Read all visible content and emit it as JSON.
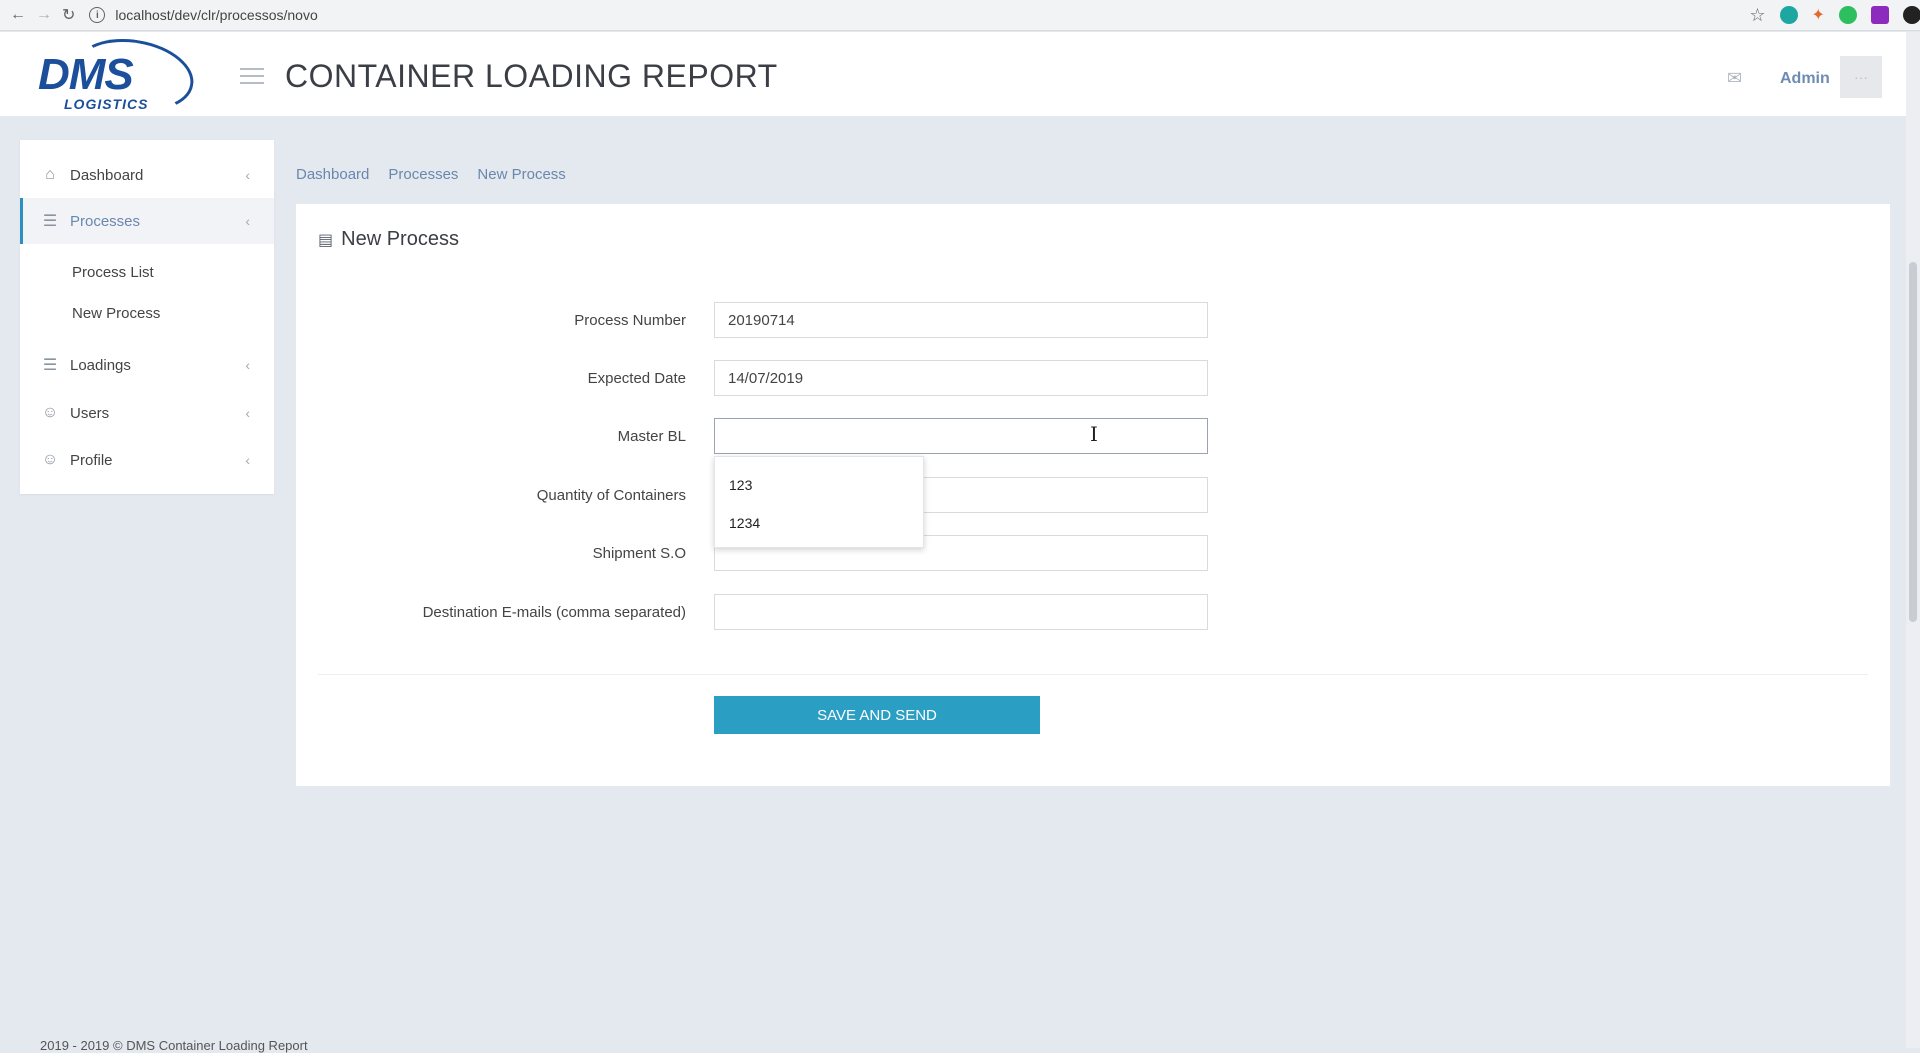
{
  "browser": {
    "url": "localhost/dev/clr/processos/novo"
  },
  "header": {
    "logo_text": "DMS",
    "logo_sub": "LOGISTICS",
    "title": "CONTAINER LOADING REPORT",
    "user": "Admin"
  },
  "sidebar": {
    "items": [
      {
        "label": "Dashboard",
        "icon": "home-icon"
      },
      {
        "label": "Processes",
        "icon": "list-icon",
        "active": true
      },
      {
        "label": "Loadings",
        "icon": "list-icon"
      },
      {
        "label": "Users",
        "icon": "user-icon"
      },
      {
        "label": "Profile",
        "icon": "user-icon"
      }
    ],
    "sub_items": [
      "Process List",
      "New Process"
    ]
  },
  "breadcrumb": [
    "Dashboard",
    "Processes",
    "New Process"
  ],
  "panel": {
    "title": "New Process",
    "fields": [
      {
        "label": "Process Number",
        "value": "20190714"
      },
      {
        "label": "Expected Date",
        "value": "14/07/2019"
      },
      {
        "label": "Master BL",
        "value": ""
      },
      {
        "label": "Quantity of Containers",
        "value": ""
      },
      {
        "label": "Shipment S.O",
        "value": ""
      },
      {
        "label": "Destination E-mails (comma separated)",
        "value": ""
      }
    ],
    "autocomplete": [
      "123",
      "1234"
    ],
    "save_label": "SAVE AND SEND"
  },
  "footer": "2019 - 2019 © DMS Container Loading Report",
  "colors": {
    "accent": "#2b9ec4",
    "brand": "#1b4f9c",
    "link": "#6a88ad",
    "background": "#e4e8ef"
  }
}
